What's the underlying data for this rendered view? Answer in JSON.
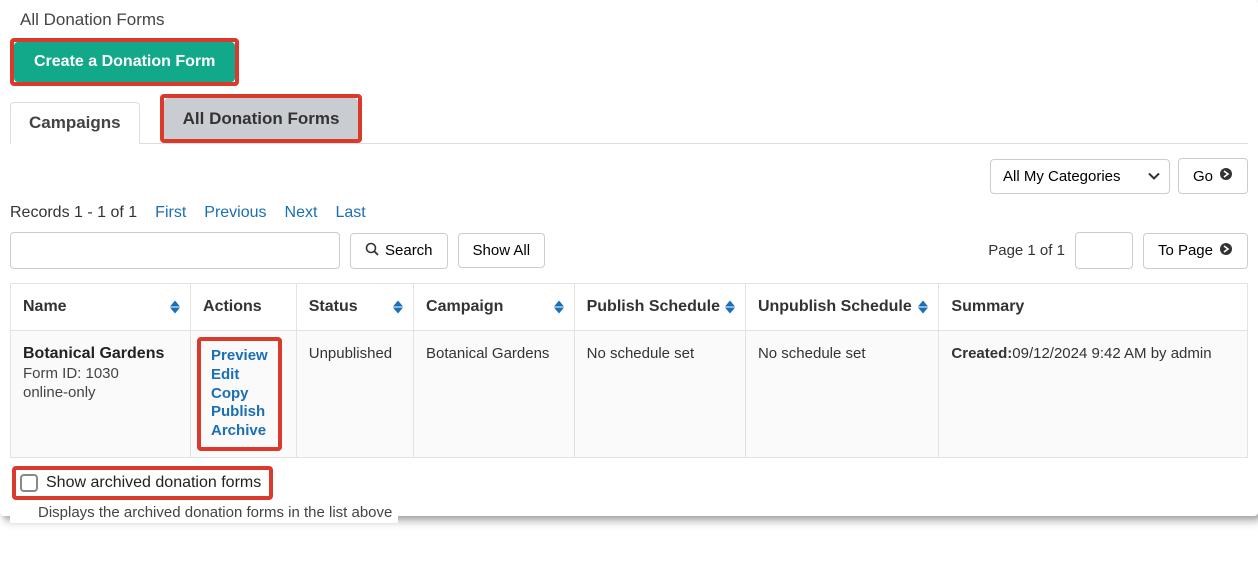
{
  "page": {
    "heading": "All Donation Forms"
  },
  "create_button": {
    "label": "Create a Donation Form"
  },
  "tabs": {
    "campaigns": "Campaigns",
    "all_forms": "All Donation Forms"
  },
  "filter": {
    "category_selected": "All My Categories",
    "go_label": "Go"
  },
  "pager": {
    "records_text": "Records 1 - 1 of 1",
    "first": "First",
    "previous": "Previous",
    "next": "Next",
    "last": "Last",
    "page_info": "Page 1 of 1",
    "to_page_label": "To Page"
  },
  "search": {
    "search_label": "Search",
    "show_all_label": "Show All"
  },
  "table": {
    "headers": {
      "name": "Name",
      "actions": "Actions",
      "status": "Status",
      "campaign": "Campaign",
      "publish": "Publish Schedule",
      "unpublish": "Unpublish Schedule",
      "summary": "Summary"
    },
    "rows": [
      {
        "name": "Botanical Gardens",
        "form_id_line": "Form ID: 1030",
        "channel": "online-only",
        "actions": {
          "preview": "Preview",
          "edit": "Edit",
          "copy": "Copy",
          "publish": "Publish",
          "archive": "Archive"
        },
        "status": "Unpublished",
        "campaign": "Botanical Gardens",
        "publish_schedule": "No schedule set",
        "unpublish_schedule": "No schedule set",
        "summary_label": "Created:",
        "summary_value": "09/12/2024 9:42 AM by admin"
      }
    ]
  },
  "archived": {
    "label": "Show archived donation forms",
    "desc": "Displays the archived donation forms in the list above"
  }
}
